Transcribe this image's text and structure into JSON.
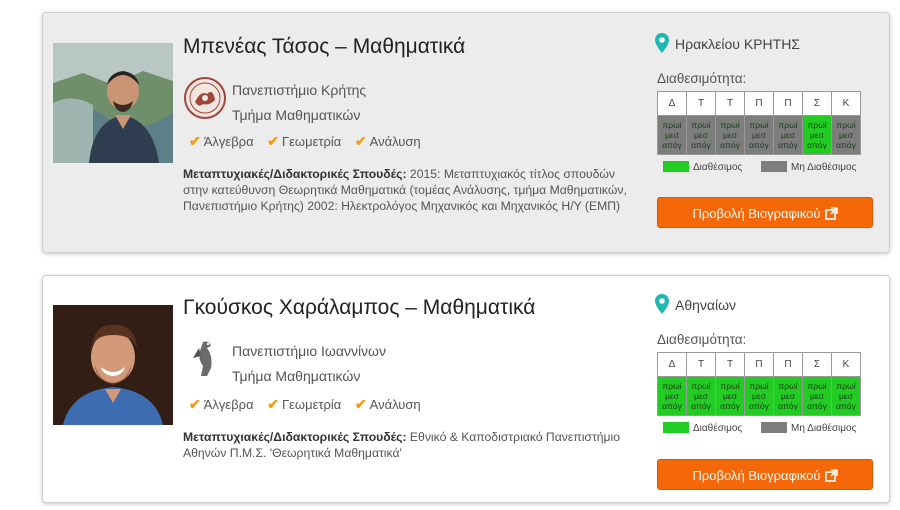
{
  "legend_colors": {
    "available": "#22cc22",
    "unavailable": "#7d7d7d",
    "accent": "#f5680a",
    "check": "#f39c12",
    "pin": "#1fb8b0"
  },
  "tutors": [
    {
      "name": "Μπενέας Τάσος – Μαθηματικά",
      "university": "Πανεπιστήμιο Κρήτης",
      "department": "Τμήμα Μαθηματικών",
      "subjects": [
        "Άλγεβρα",
        "Γεωμετρία",
        "Ανάλυση"
      ],
      "studies_label": "Μεταπτυχιακές/Διδακτορικές Σπουδές:",
      "studies_text": " 2015: Μεταπτυχιακός τίτλος σπουδών στην κατεύθυνση Θεωρητικά Μαθηματικά (τομέας Ανάλυσης, τμήμα Μαθηματικών, Πανεπιστήμιο Κρήτης)  2002: Ηλεκτρολόγος Μηχανικός και Μηχανικός Η/Υ (ΕΜΠ)",
      "location": "Ηρακλείου ΚΡΗΤΗΣ",
      "availability_label": "Διαθεσιμότητα:",
      "days": [
        "Δ",
        "Τ",
        "Τ",
        "Π",
        "Π",
        "Σ",
        "Κ"
      ],
      "slots": [
        "πρωί",
        "μεσ",
        "απόγ"
      ],
      "availability": [
        "unavailable",
        "unavailable",
        "unavailable",
        "unavailable",
        "unavailable",
        "available",
        "unavailable"
      ],
      "legend_available": "Διαθέσιμος",
      "legend_unavailable": "Μη Διαθέσιμος",
      "button_label": "Προβολή Βιογραφικού"
    },
    {
      "name": "Γκούσκος Χαράλαμπος – Μαθηματικά",
      "university": "Πανεπιστήμιο Ιωαννίνων",
      "department": "Τμήμα Μαθηματικών",
      "subjects": [
        "Άλγεβρα",
        "Γεωμετρία",
        "Ανάλυση"
      ],
      "studies_label": "Μεταπτυχιακές/Διδακτορικές Σπουδές:",
      "studies_text": " Εθνικό & Καποδιστριακό Πανεπιστήμιο Αθηνών Π.Μ.Σ. 'Θεωρητικά Μαθηματικά'",
      "location": "Αθηναίων",
      "availability_label": "Διαθεσιμότητα:",
      "days": [
        "Δ",
        "Τ",
        "Τ",
        "Π",
        "Π",
        "Σ",
        "Κ"
      ],
      "slots": [
        "πρωί",
        "μεσ",
        "απόγ"
      ],
      "availability": [
        "available",
        "available",
        "available",
        "available",
        "available",
        "available",
        "available"
      ],
      "legend_available": "Διαθέσιμος",
      "legend_unavailable": "Μη Διαθέσιμος",
      "button_label": "Προβολή Βιογραφικού"
    }
  ]
}
